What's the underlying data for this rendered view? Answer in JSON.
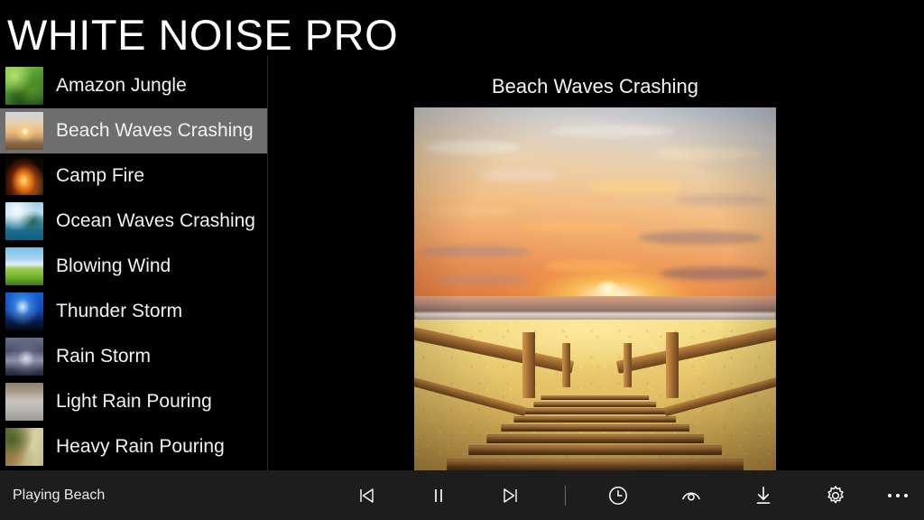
{
  "app": {
    "title": "WHITE NOISE PRO"
  },
  "sidebar": {
    "items": [
      {
        "label": "Amazon Jungle",
        "thumb": "jungle-thumbnail",
        "selected": false
      },
      {
        "label": "Beach Waves Crashing",
        "thumb": "beach-sunset-thumbnail",
        "selected": true
      },
      {
        "label": "Camp Fire",
        "thumb": "campfire-thumbnail",
        "selected": false
      },
      {
        "label": "Ocean Waves Crashing",
        "thumb": "ocean-thumbnail",
        "selected": false
      },
      {
        "label": "Blowing Wind",
        "thumb": "wind-field-thumbnail",
        "selected": false
      },
      {
        "label": "Thunder Storm",
        "thumb": "thunder-lightning-thumbnail",
        "selected": false
      },
      {
        "label": "Rain Storm",
        "thumb": "rain-storm-thumbnail",
        "selected": false
      },
      {
        "label": "Light Rain Pouring",
        "thumb": "light-rain-thumbnail",
        "selected": false
      },
      {
        "label": "Heavy Rain Pouring",
        "thumb": "heavy-rain-thumbnail",
        "selected": false
      }
    ]
  },
  "main": {
    "title": "Beach Waves Crashing",
    "artwork": "beach-sunset-stairs-photo"
  },
  "toolbar": {
    "status": "Playing Beach",
    "controls": [
      {
        "name": "previous-button",
        "icon": "previous-track-icon"
      },
      {
        "name": "pause-button",
        "icon": "pause-icon"
      },
      {
        "name": "next-button",
        "icon": "next-track-icon"
      },
      {
        "name": "timer-button",
        "icon": "clock-icon"
      },
      {
        "name": "fade-button",
        "icon": "eye-icon"
      },
      {
        "name": "download-button",
        "icon": "download-icon"
      },
      {
        "name": "settings-button",
        "icon": "gear-icon"
      },
      {
        "name": "more-button",
        "icon": "ellipsis-icon"
      }
    ]
  },
  "colors": {
    "background": "#000000",
    "toolbar_background": "#1d1d1d",
    "selection": "#6e6e6e",
    "text": "#ffffff"
  }
}
